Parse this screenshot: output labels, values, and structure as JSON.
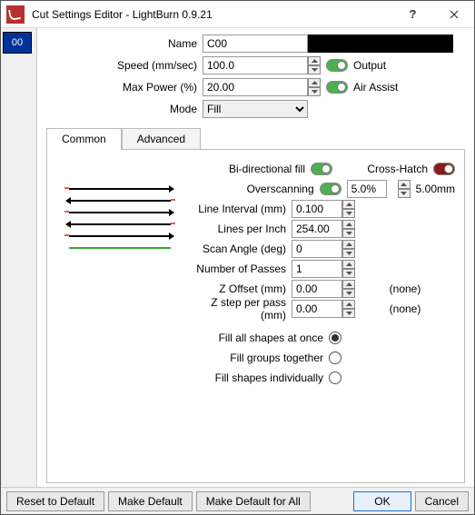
{
  "window": {
    "title": "Cut Settings Editor - LightBurn 0.9.21"
  },
  "layer": {
    "code": "00"
  },
  "top": {
    "name_label": "Name",
    "name_value": "C00",
    "speed_label": "Speed (mm/sec)",
    "speed_value": "100.0",
    "power_label": "Max Power (%)",
    "power_value": "20.00",
    "mode_label": "Mode",
    "mode_value": "Fill",
    "output_label": "Output",
    "air_label": "Air Assist"
  },
  "tabs": {
    "common": "Common",
    "advanced": "Advanced"
  },
  "fill": {
    "bidir_label": "Bi-directional fill",
    "cross_label": "Cross-Hatch",
    "overscan_label": "Overscanning",
    "overscan_pct": "5.0%",
    "overscan_mm": "5.00mm",
    "interval_label": "Line Interval (mm)",
    "interval_val": "0.100",
    "lpi_label": "Lines per Inch",
    "lpi_val": "254.00",
    "angle_label": "Scan Angle (deg)",
    "angle_val": "0",
    "passes_label": "Number of Passes",
    "passes_val": "1",
    "zoff_label": "Z Offset (mm)",
    "zoff_val": "0.00",
    "zoff_extra": "(none)",
    "zstep_label": "Z step per pass (mm)",
    "zstep_val": "0.00",
    "zstep_extra": "(none)",
    "r1": "Fill all shapes at once",
    "r2": "Fill groups together",
    "r3": "Fill shapes individually"
  },
  "footer": {
    "reset": "Reset to Default",
    "makedef": "Make Default",
    "makedefall": "Make Default for All",
    "ok": "OK",
    "cancel": "Cancel"
  }
}
